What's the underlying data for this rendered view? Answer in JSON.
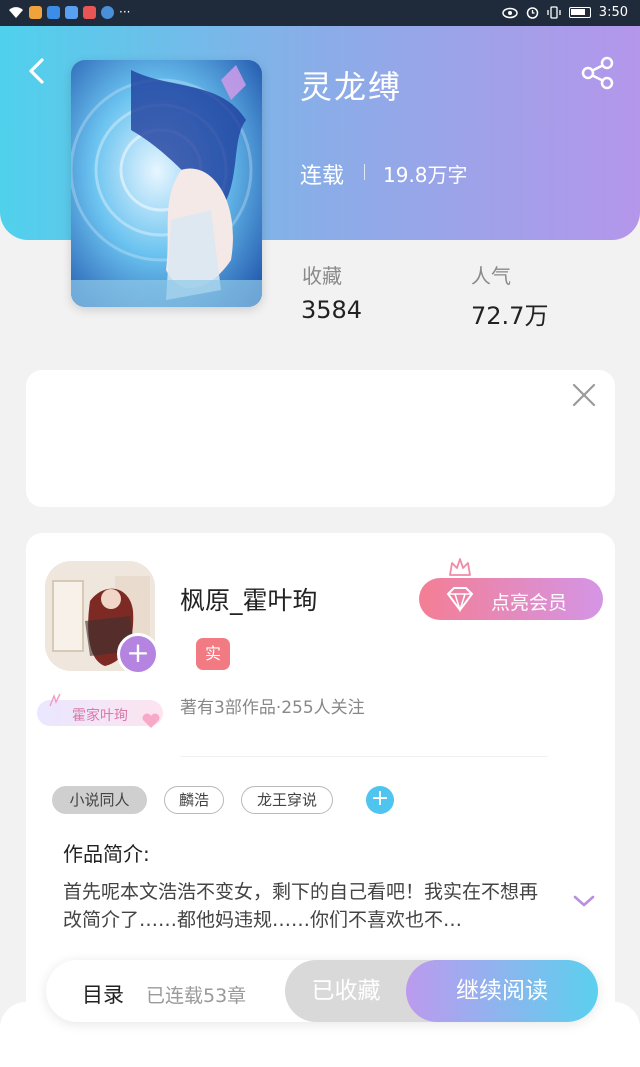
{
  "status_bar": {
    "time": "3:50",
    "more": "···",
    "icons": [
      "wifi-icon",
      "signal-icon",
      "app-icons",
      "eye-icon",
      "alarm-icon",
      "vibrate-icon",
      "battery-icon"
    ]
  },
  "header": {
    "back_icon": "chevron-left-icon",
    "share_icon": "share-icon"
  },
  "book": {
    "title": "灵龙缚",
    "status": "连载",
    "word_count": "19.8万字",
    "stats": {
      "favorites_label": "收藏",
      "favorites_value": "3584",
      "popularity_label": "人气",
      "popularity_value": "72.7万"
    }
  },
  "author": {
    "name": "枫原_霍叶珣",
    "verified_label": "实",
    "badge_text": "霍家叶珣",
    "meta": "著有3部作品·255人关注",
    "vip_button": "点亮会员"
  },
  "tags": [
    {
      "label": "小说同人",
      "style": "filled"
    },
    {
      "label": "麟浩",
      "style": "outline"
    },
    {
      "label": "龙王穿说",
      "style": "outline"
    }
  ],
  "tag_add_label": "+",
  "intro": {
    "heading": "作品简介:",
    "text": "首先呢本文浩浩不变女，剩下的自己看吧！我实在不想再改简介了……都他妈违规……你们不喜欢也不…"
  },
  "bottom_bar": {
    "toc_label": "目录",
    "chapter_count": "已连载53章",
    "collected_label": "已收藏",
    "read_label": "继续阅读"
  },
  "colors": {
    "hero_start": "#4fd1ec",
    "hero_end": "#b496ea",
    "follow_purple": "#b584e0",
    "vip_start": "#f47e94",
    "vip_end": "#d495e6",
    "verified_red": "#f27a83",
    "tag_add_blue": "#4fc4ef"
  }
}
